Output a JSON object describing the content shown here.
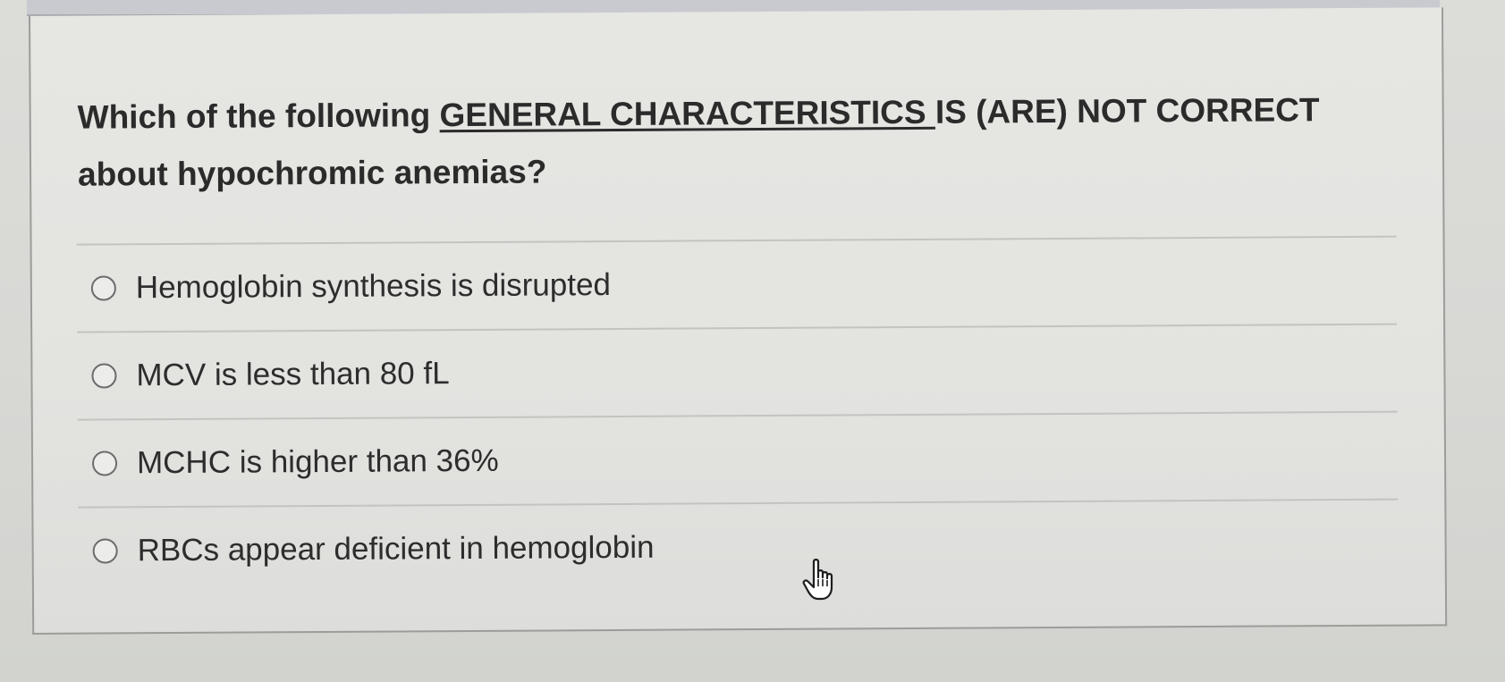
{
  "question": {
    "prefix": "Which of the following ",
    "emphasis": "GENERAL CHARACTERISTICS ",
    "suffix": "IS (ARE) NOT CORRECT about hypochromic anemias?"
  },
  "options": [
    {
      "label": "Hemoglobin synthesis is disrupted",
      "selected": false
    },
    {
      "label": "MCV is less than 80 fL",
      "selected": false
    },
    {
      "label": "MCHC is higher than 36%",
      "selected": false
    },
    {
      "label": "RBCs appear deficient in hemoglobin",
      "selected": false
    }
  ],
  "cursor": {
    "icon": "hand-pointer-icon"
  },
  "colors": {
    "text": "#2b2b2b",
    "background": "#e4e4e1",
    "divider": "#c3c4c1",
    "radio_border": "#6c6c6c"
  }
}
